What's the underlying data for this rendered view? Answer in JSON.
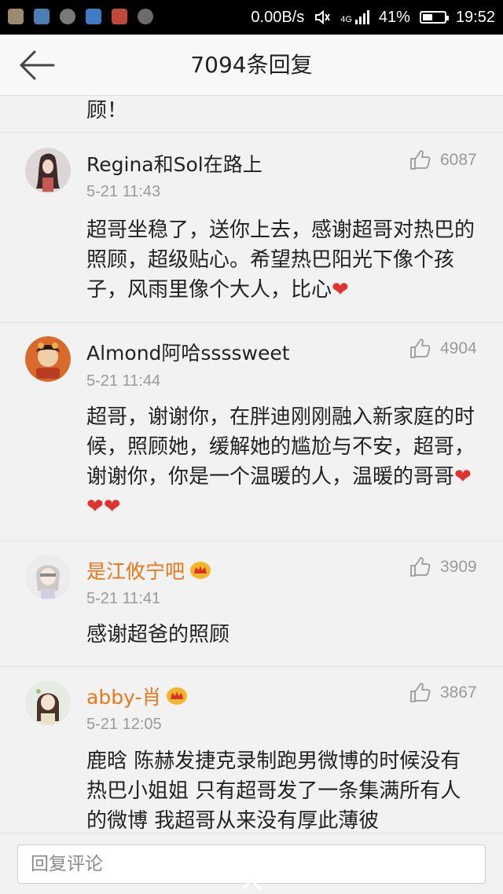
{
  "status_bar": {
    "net_speed": "0.00B/s",
    "signal": "4G",
    "battery": "41%",
    "time": "19:52",
    "notification_icons": [
      "train-icon",
      "app-icon",
      "weibo-icon",
      "app-icon",
      "app-icon",
      "chat-icon"
    ]
  },
  "header": {
    "title": "7094条回复",
    "back_icon": "back-arrow-icon"
  },
  "cut_text": "顾！",
  "comments": [
    {
      "name": "Regina和Sol在路上",
      "time": "5-21 11:43",
      "likes": "6087",
      "text": "超哥坐稳了，送你上去，感谢超哥对热巴的照顾，超级贴心。希望热巴阳光下像个孩子，风雨里像个大人，比心",
      "hearts": "❤"
    },
    {
      "name": "Almond阿哈ssssweet",
      "time": "5-21 11:44",
      "likes": "4904",
      "text": "超哥，谢谢你，在胖迪刚刚融入新家庭的时候，照顾她，缓解她的尴尬与不安，超哥，谢谢你，你是一个温暖的人，温暖的哥哥",
      "hearts": "❤❤❤"
    },
    {
      "name": "是江攸宁吧",
      "time": "5-21 11:41",
      "likes": "3909",
      "text": "感谢超爸的照顾",
      "hearts": ""
    },
    {
      "name": "abby-肖",
      "time": "5-21 12:05",
      "likes": "3867",
      "text": "鹿晗 陈赫发捷克录制跑男微博的时候没有热巴小姐姐 只有超哥发了一条集满所有人的微博 我超哥从来没有厚此薄彼",
      "hearts": ""
    }
  ],
  "reply_bar": {
    "placeholder": "回复评论"
  },
  "colors": {
    "vip_name": "#e8781a",
    "heart": "#e0332e",
    "meta_gray": "#9a9a9a"
  }
}
